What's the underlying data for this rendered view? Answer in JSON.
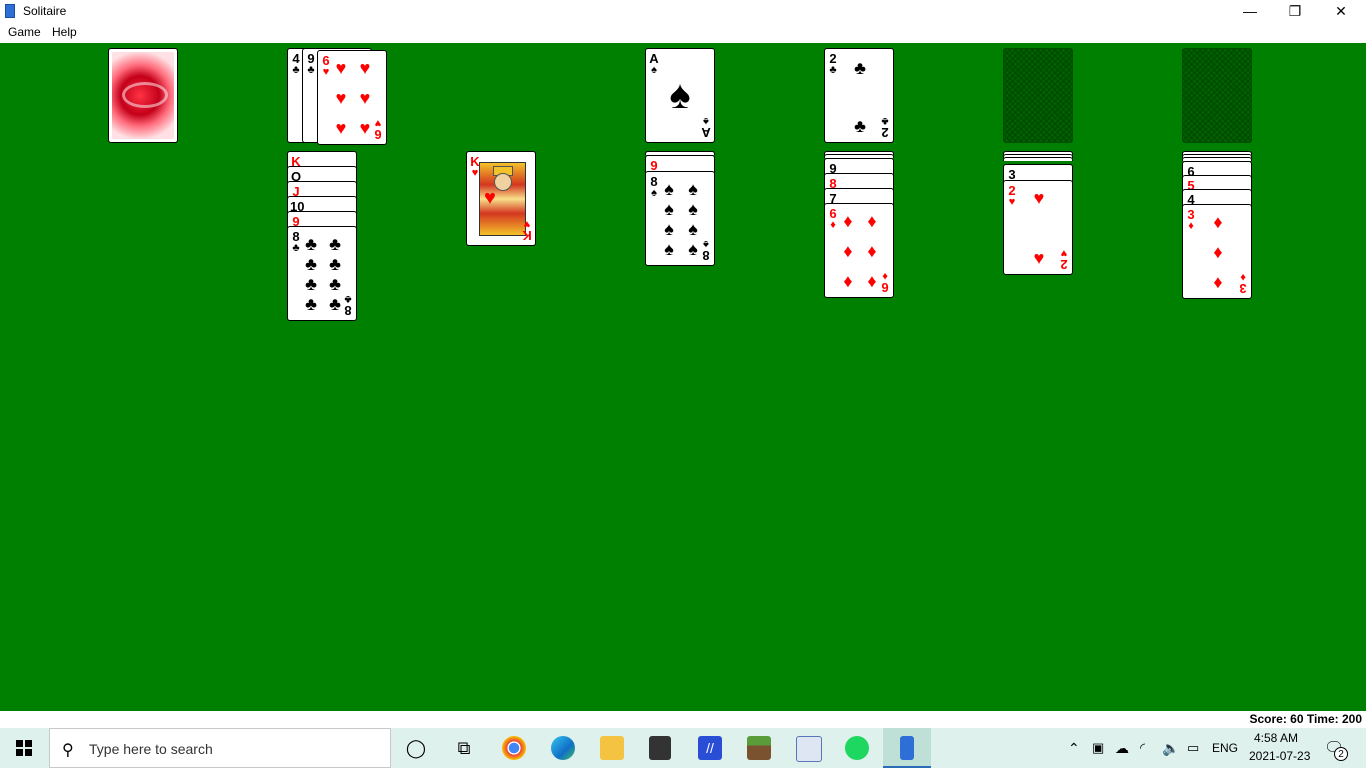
{
  "window": {
    "title": "Solitaire",
    "min_glyph": "—",
    "max_glyph": "❐",
    "close_glyph": "✕"
  },
  "menu": {
    "items": [
      "Game",
      "Help"
    ]
  },
  "status": {
    "text": "Score: 60 Time: 200"
  },
  "cards": {
    "waste": [
      {
        "rank": "4",
        "suit": "♣"
      },
      {
        "rank": "9",
        "suit": "♣"
      },
      {
        "rank": "6",
        "suit": "♥"
      }
    ],
    "foundation_1": {
      "rank": "A",
      "suit": "♠"
    },
    "foundation_2": {
      "rank": "2",
      "suit": "♣"
    },
    "tableau_1": [
      "K♥",
      "Q♣",
      "J♥",
      "10♣",
      "9♥",
      "8♣"
    ],
    "tableau_2": [
      "K♥"
    ],
    "tableau_3": [
      "9♥",
      "8♠"
    ],
    "tableau_4": [
      "9♠",
      "8♥",
      "7♠",
      "6♦"
    ],
    "tableau_5": [
      "3♠",
      "2♥"
    ],
    "tableau_6": [
      "6♠",
      "5♥",
      "4♠",
      "3♦"
    ]
  },
  "taskbar": {
    "search_placeholder": "Type here to search",
    "language": "ENG",
    "time": "4:58 AM",
    "date": "2021-07-23",
    "notification_count": "2",
    "icons": [
      "cortana-icon",
      "task-view-icon",
      "chrome-icon",
      "edge-icon",
      "file-explorer-icon",
      "store-icon",
      "app-icon",
      "minecraft-icon",
      "paint-icon",
      "spotify-icon",
      "solitaire-icon"
    ]
  }
}
